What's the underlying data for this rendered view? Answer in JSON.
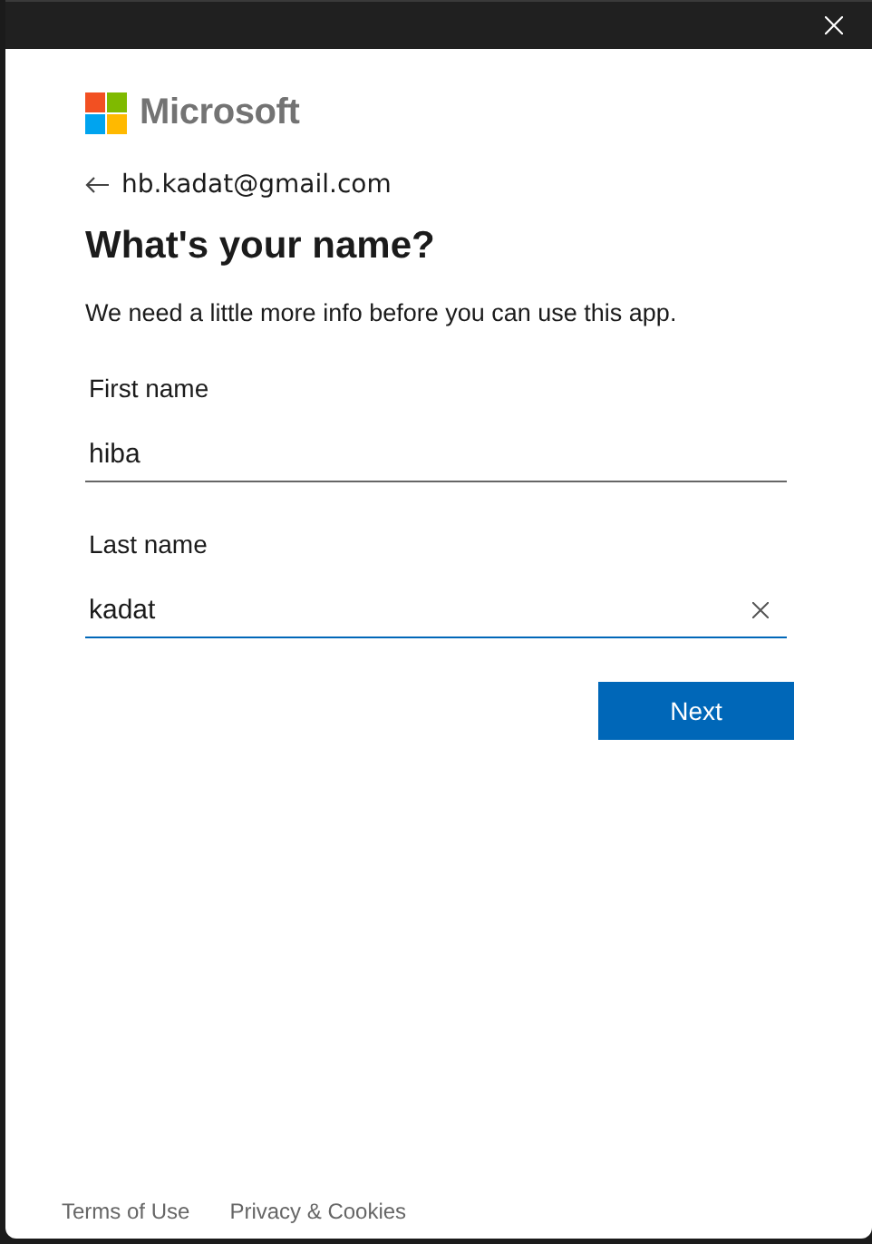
{
  "brand": {
    "name": "Microsoft"
  },
  "account": {
    "email": "hb.kadat@gmail.com"
  },
  "heading": "What's your name?",
  "description": "We need a little more info before you can use this app.",
  "fields": [
    {
      "label": "First name",
      "value": "hiba",
      "focused": false,
      "clearable": false
    },
    {
      "label": "Last name",
      "value": "kadat",
      "focused": true,
      "clearable": true
    }
  ],
  "primary_button": "Next",
  "footer_links": [
    "Terms of Use",
    "Privacy & Cookies"
  ]
}
